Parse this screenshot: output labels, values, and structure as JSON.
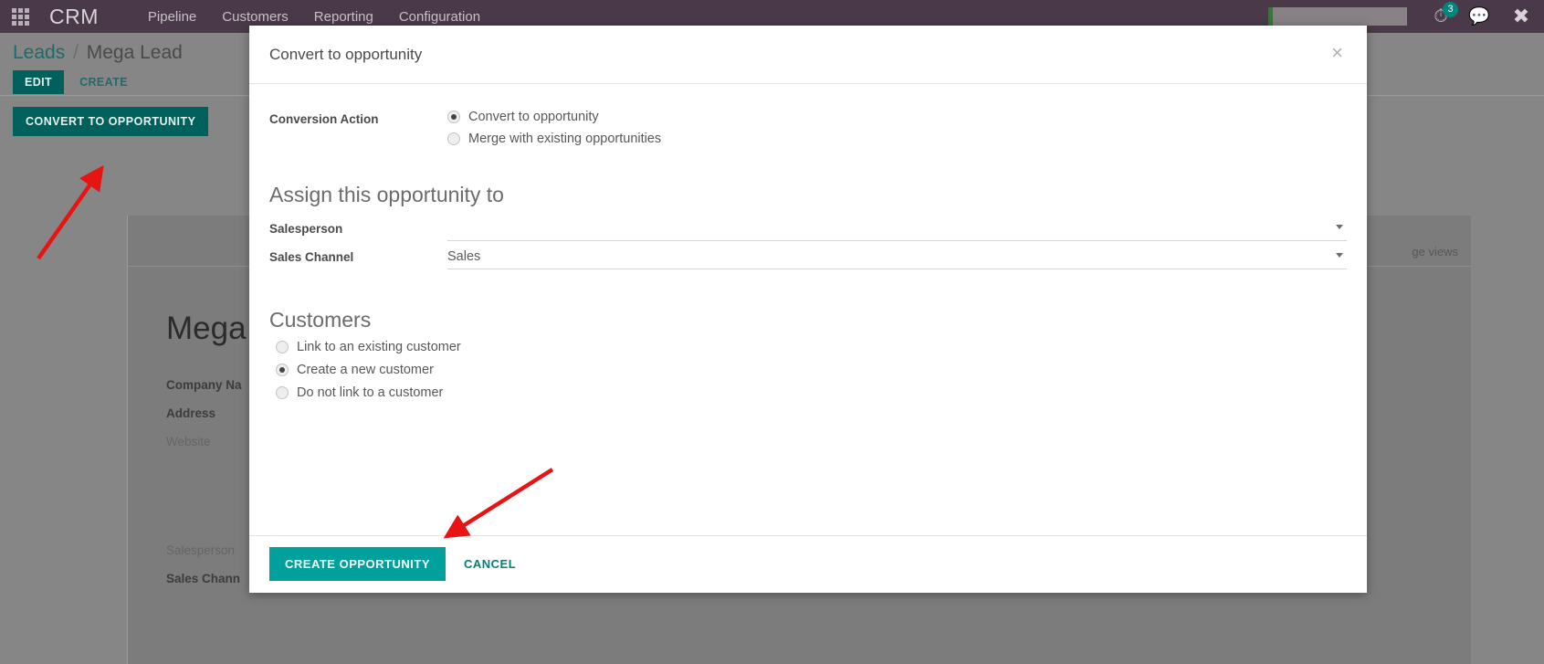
{
  "topnav": {
    "apps_icon": "apps-grid-icon",
    "brand": "CRM",
    "menu": [
      "Pipeline",
      "Customers",
      "Reporting",
      "Configuration"
    ],
    "clock_icon": "activity-clock-icon",
    "activity_badge": "3",
    "chat_icon": "chat-bubble-icon",
    "tools_icon": "tools-icon"
  },
  "control_panel": {
    "breadcrumb_root": "Leads",
    "breadcrumb_separator": "/",
    "breadcrumb_current": "Mega Lead",
    "edit_label": "EDIT",
    "create_label": "CREATE",
    "convert_label": "CONVERT TO OPPORTUNITY"
  },
  "record": {
    "view_switcher": "ge views",
    "title": "Mega",
    "fields": [
      {
        "label": "Company Na",
        "muted": false
      },
      {
        "label": "Address",
        "muted": false
      },
      {
        "label": "Website",
        "muted": true
      }
    ],
    "fields_lower": [
      {
        "label": "Salesperson",
        "muted": true
      },
      {
        "label": "Sales Chann",
        "muted": false
      }
    ]
  },
  "modal": {
    "title": "Convert to opportunity",
    "close_icon": "×",
    "conversion": {
      "label": "Conversion Action",
      "options": [
        {
          "label": "Convert to opportunity",
          "selected": true
        },
        {
          "label": "Merge with existing opportunities",
          "selected": false
        }
      ]
    },
    "assign": {
      "heading": "Assign this opportunity to",
      "salesperson_label": "Salesperson",
      "salesperson_value": "",
      "sales_channel_label": "Sales Channel",
      "sales_channel_value": "Sales",
      "caret_icon": "chevron-down-icon"
    },
    "customers": {
      "heading": "Customers",
      "options": [
        {
          "label": "Link to an existing customer",
          "selected": false
        },
        {
          "label": "Create a new customer",
          "selected": true
        },
        {
          "label": "Do not link to a customer",
          "selected": false
        }
      ]
    },
    "footer": {
      "primary_label": "CREATE OPPORTUNITY",
      "cancel_label": "CANCEL"
    }
  },
  "annotations": {
    "arrow_color": "#e81313",
    "arrows": [
      {
        "name": "arrow-to-convert-button"
      },
      {
        "name": "arrow-to-create-opportunity-button"
      }
    ]
  },
  "colors": {
    "navbar": "#4a3a49",
    "primary_teal": "#00a09d",
    "dark_teal": "#00605c",
    "page_grey": "#868686"
  }
}
